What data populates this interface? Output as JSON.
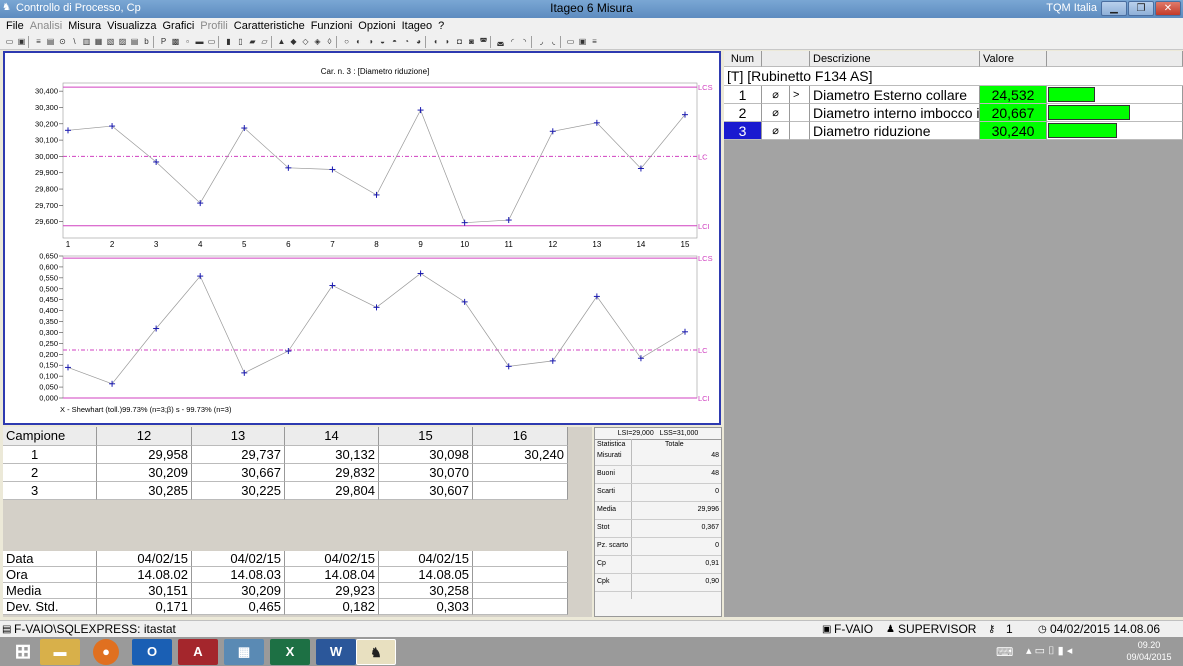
{
  "window": {
    "app_title": "Controllo di Processo, Cp",
    "center_title": "Itageo 6 Misura",
    "right_title": "TQM Italia"
  },
  "menu": [
    "File",
    "Analisi",
    "Misura",
    "Visualizza",
    "Grafici",
    "Profili",
    "Caratteristiche",
    "Funzioni",
    "Opzioni",
    "Itageo",
    "?"
  ],
  "menu_disabled": [
    "Analisi",
    "Profili"
  ],
  "chart_data": [
    {
      "type": "line",
      "title": "Car. n. 3 : [Diametro riduzione]",
      "x": [
        1,
        2,
        3,
        4,
        5,
        6,
        7,
        8,
        9,
        10,
        11,
        12,
        13,
        14,
        15
      ],
      "series": [
        {
          "values": [
            30.16,
            30.186,
            29.966,
            29.714,
            30.174,
            29.93,
            29.92,
            29.764,
            30.284,
            29.594,
            29.61,
            30.154,
            30.206,
            29.926,
            30.256
          ]
        }
      ],
      "limits": {
        "LCS": 30.425,
        "LC": 30.0,
        "LCI": 29.575
      },
      "ylim": [
        29.5,
        30.45
      ],
      "yticks": [
        "29,600",
        "29,700",
        "29,800",
        "29,900",
        "30,000",
        "30,100",
        "30,200",
        "30,300",
        "30,400"
      ],
      "limit_labels": [
        "LCS",
        "LC",
        "LCI"
      ]
    },
    {
      "type": "line",
      "x": [
        1,
        2,
        3,
        4,
        5,
        6,
        7,
        8,
        9,
        10,
        11,
        12,
        13,
        14,
        15
      ],
      "series": [
        {
          "values": [
            0.14,
            0.065,
            0.318,
            0.558,
            0.115,
            0.215,
            0.515,
            0.415,
            0.57,
            0.44,
            0.145,
            0.17,
            0.465,
            0.182,
            0.303
          ]
        }
      ],
      "limits": {
        "LCS": 0.64,
        "LC": 0.22,
        "LCI": 0.0
      },
      "ylim": [
        0,
        0.65
      ],
      "yticks": [
        "0,000",
        "0,050",
        "0,100",
        "0,150",
        "0,200",
        "0,250",
        "0,300",
        "0,350",
        "0,400",
        "0,450",
        "0,500",
        "0,550",
        "0,600",
        "0,650"
      ],
      "limit_labels": [
        "LCS",
        "LC",
        "LCI"
      ],
      "caption": "X - Shewhart (toll.)99.73% (n=3;β) s - 99.73% (n=3)"
    }
  ],
  "grid": {
    "header": "Campione",
    "columns": [
      "12",
      "13",
      "14",
      "15",
      "16"
    ],
    "rows": [
      {
        "label": "1",
        "values": [
          "29,958",
          "29,737",
          "30,132",
          "30,098",
          "30,240"
        ]
      },
      {
        "label": "2",
        "values": [
          "30,209",
          "30,667",
          "29,832",
          "30,070",
          ""
        ]
      },
      {
        "label": "3",
        "values": [
          "30,285",
          "30,225",
          "29,804",
          "30,607",
          ""
        ]
      }
    ],
    "footer": [
      {
        "label": "Data",
        "values": [
          "04/02/15",
          "04/02/15",
          "04/02/15",
          "04/02/15",
          ""
        ]
      },
      {
        "label": "Ora",
        "values": [
          "14.08.02",
          "14.08.03",
          "14.08.04",
          "14.08.05",
          ""
        ]
      },
      {
        "label": "Media",
        "values": [
          "30,151",
          "30,209",
          "29,923",
          "30,258",
          ""
        ]
      },
      {
        "label": "Dev. Std.",
        "values": [
          "0,171",
          "0,465",
          "0,182",
          "0,303",
          ""
        ]
      }
    ]
  },
  "stats": {
    "lsi": "LSI=29,000",
    "lss": "LSS=31,000",
    "col1": "Statistica",
    "col2": "Totale",
    "rows": [
      {
        "label": "Misurati",
        "value": "48"
      },
      {
        "label": "Buoni",
        "value": "48"
      },
      {
        "label": "Scarti",
        "value": "0"
      },
      {
        "label": "Media",
        "value": "29,996"
      },
      {
        "label": "Stot",
        "value": "0,367"
      },
      {
        "label": "Pz. scarto",
        "value": "0"
      },
      {
        "label": "Cp",
        "value": "0,91"
      },
      {
        "label": "Cpk",
        "value": "0,90"
      }
    ]
  },
  "features": {
    "headers": {
      "num": "Num",
      "desc": "Descrizione",
      "val": "Valore"
    },
    "group": "[T] [Rubinetto F134 AS]",
    "rows": [
      {
        "num": "1",
        "sym": "⌀",
        "marker": ">",
        "desc": "Diametro Esterno collare",
        "value": "24,532",
        "fill": 0.35
      },
      {
        "num": "2",
        "sym": "⌀",
        "marker": "",
        "desc": "Diametro interno imbocco ir",
        "value": "20,667",
        "fill": 0.62
      },
      {
        "num": "3",
        "sym": "⌀",
        "marker": "",
        "desc": "Diametro riduzione",
        "value": "30,240",
        "fill": 0.52
      }
    ]
  },
  "status": {
    "db": "F-VAIO\\SQLEXPRESS: itastat",
    "host": "F-VAIO",
    "user": "SUPERVISOR",
    "count": "1",
    "datetime": "04/02/2015 14.08.06"
  },
  "clock": {
    "time": "09.20",
    "date": "09/04/2015"
  },
  "colors": {
    "accent": "#2e3ab0",
    "limit": "#d040c0",
    "point": "#1a1ab0",
    "ok": "#00ff00",
    "select": "#1a1ad0"
  }
}
